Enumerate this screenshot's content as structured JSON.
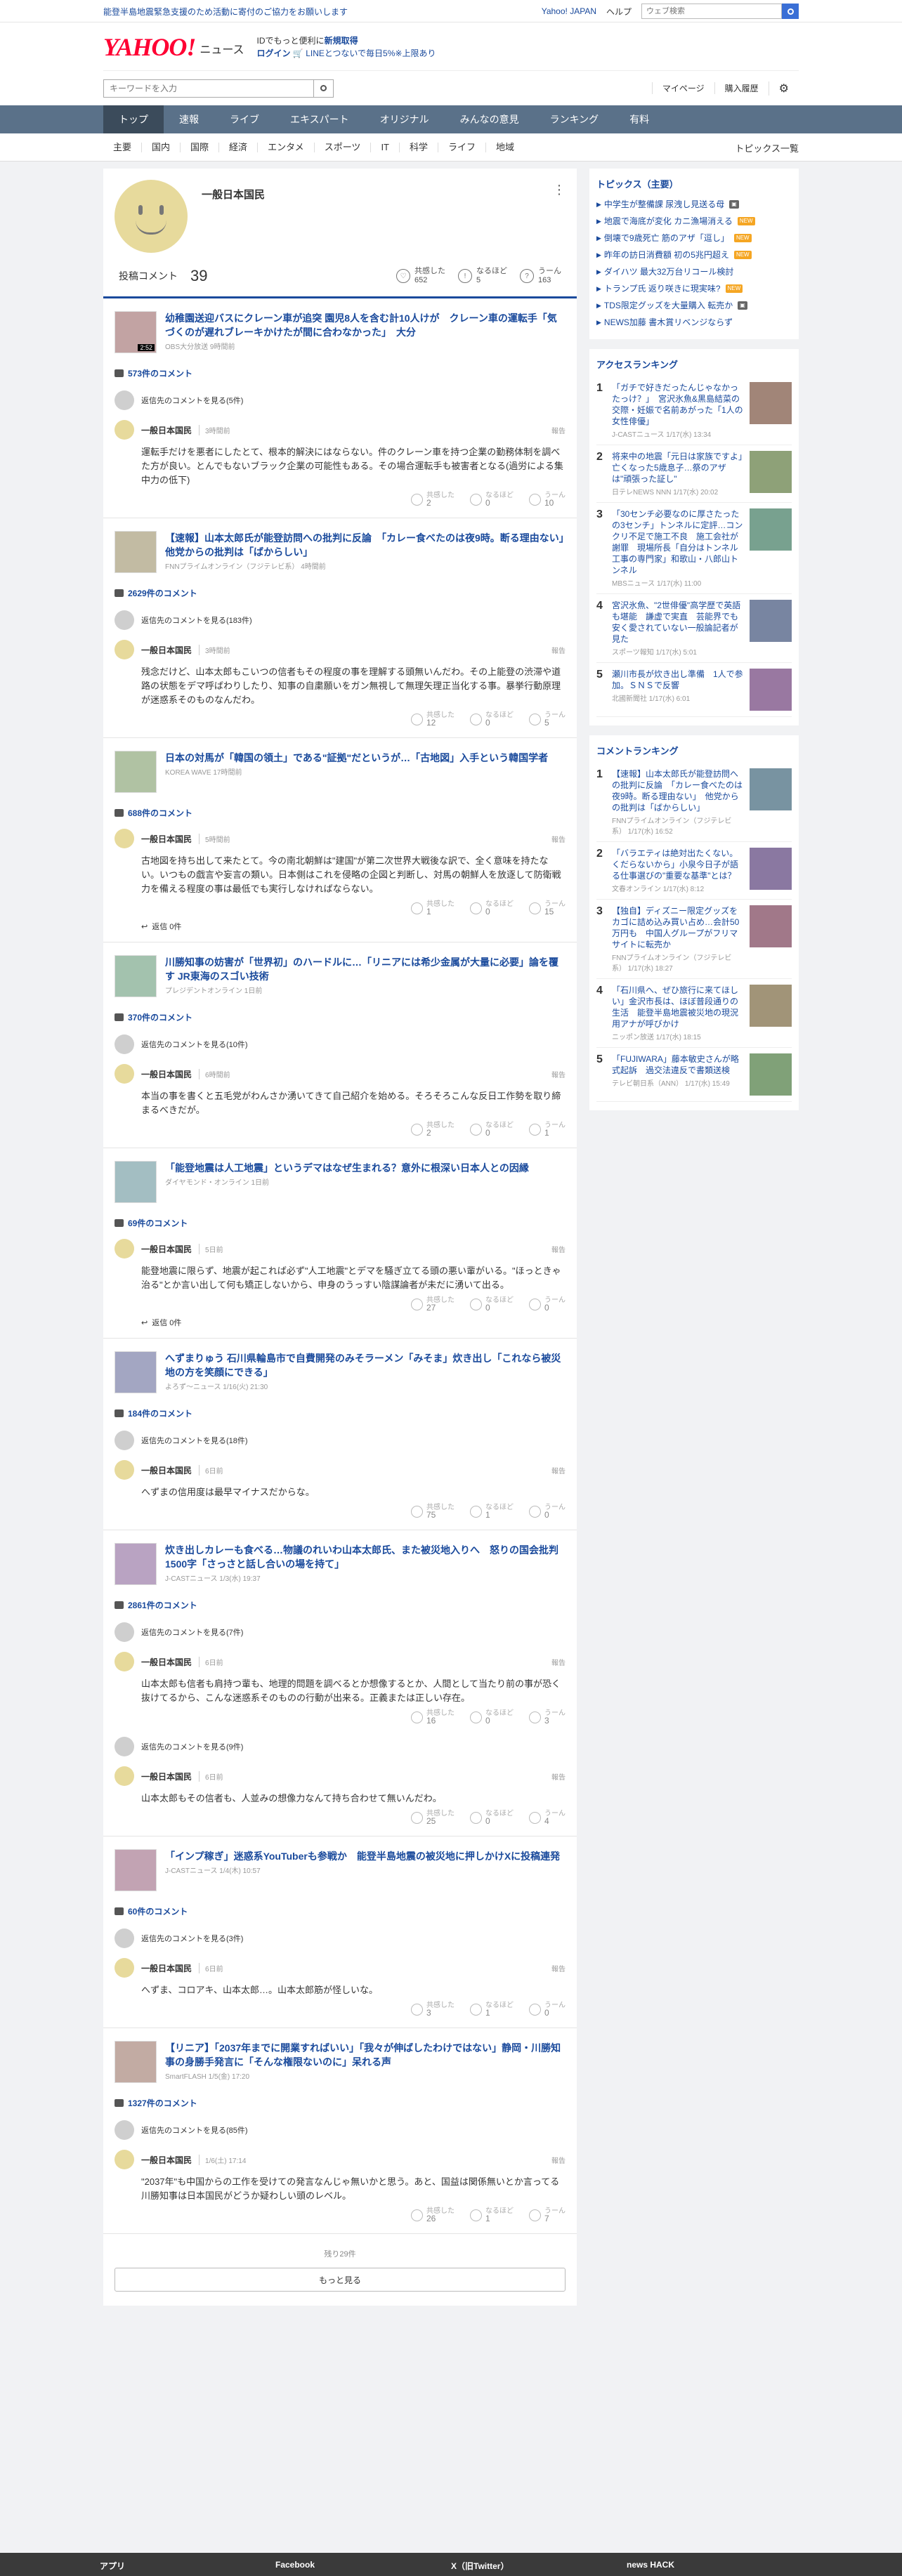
{
  "topbar": {
    "notice": "能登半島地震緊急支援のため活動に寄付のご協力をお願いします",
    "yahoo_japan": "Yahoo! JAPAN",
    "help": "ヘルプ",
    "search_placeholder": "ウェブ検索"
  },
  "header": {
    "logo_text": "YAHOO!",
    "logo_sub": "JAPAN",
    "service": "ニュース",
    "promo_line1": "IDでもっと便利に",
    "promo_new": "新規取得",
    "promo_login": "ログイン",
    "promo_line2": "LINEとつないで毎日5%※上限あり"
  },
  "search": {
    "placeholder": "キーワードを入力",
    "mypage": "マイページ",
    "purchase": "購入履歴"
  },
  "gnav": [
    "トップ",
    "速報",
    "ライブ",
    "エキスパート",
    "オリジナル",
    "みんなの意見",
    "ランキング",
    "有料"
  ],
  "snav": [
    "主要",
    "国内",
    "国際",
    "経済",
    "エンタメ",
    "スポーツ",
    "IT",
    "科学",
    "ライフ",
    "地域"
  ],
  "snav_right": "トピックス一覧",
  "profile": {
    "name": "一般日本国民",
    "comment_label": "投稿コメント",
    "comment_count": "39",
    "r1_label": "共感した",
    "r1": "652",
    "r2_label": "なるほど",
    "r2": "5",
    "r3_label": "うーん",
    "r3": "163"
  },
  "labels": {
    "more_replies": "返信先のコメントを見る",
    "report": "報告",
    "reply": "返信 0件",
    "empathy": "共感した",
    "naruhodo": "なるほど",
    "uun": "うーん",
    "user": "一般日本国民"
  },
  "articles": [
    {
      "title": "幼稚園送迎バスにクレーン車が追突 園児8人を含む計10人けが　クレーン車の運転手「気づくのが遅れブレーキかけたが間に合わなかった」　大分",
      "src": "OBS大分放送 9時間前",
      "thumb_time": "2:52",
      "count": "573件のコメント",
      "more": "返信先のコメントを見る(5件)",
      "comments": [
        {
          "time": "3時間前",
          "text": "運転手だけを悪者にしたとて、根本的解決にはならない。件のクレーン車を持つ企業の勤務体制を調べた方が良い。とんでもないブラック企業の可能性もある。その場合運転手も被害者となる(過労による集中力の低下)",
          "r": [
            "2",
            "0",
            "10"
          ]
        }
      ]
    },
    {
      "title": "【速報】山本太郎氏が能登訪問への批判に反論　「カレー食べたのは夜9時。断る理由ない」　他党からの批判は「ばからしい」",
      "src": "FNNプライムオンライン（フジテレビ系） 4時間前",
      "count": "2629件のコメント",
      "more": "返信先のコメントを見る(183件)",
      "comments": [
        {
          "time": "3時間前",
          "text": "残念だけど、山本太郎もこいつの信者もその程度の事を理解する頭無いんだわ。その上能登の渋滞や道路の状態をデマ呼ばわりしたり、知事の自粛願いをガン無視して無理矢理正当化する事。暴挙行動原理が迷惑系そのものなんだわ。",
          "r": [
            "12",
            "0",
            "5"
          ]
        }
      ]
    },
    {
      "title": "日本の対馬が「韓国の領土」である\"証拠\"だというが…「古地図」入手という韓国学者",
      "src": "KOREA WAVE 17時間前",
      "count": "688件のコメント",
      "more": "",
      "comments": [
        {
          "time": "5時間前",
          "text": "古地図を持ち出して来たとて。今の南北朝鮮は\"建国\"が第二次世界大戦後な訳で、全く意味を持たない。いつもの戯言や妄言の類い。日本側はこれを侵略の企図と判断し、対馬の朝鮮人を放逐して防衛戦力を備える程度の事は最低でも実行しなければならない。",
          "r": [
            "1",
            "0",
            "15"
          ],
          "reply": true
        }
      ]
    },
    {
      "title": "川勝知事の妨害が「世界初」のハードルに…「リニアには希少金属が大量に必要」論を覆す JR東海のスゴい技術",
      "src": "プレジデントオンライン 1日前",
      "count": "370件のコメント",
      "more": "返信先のコメントを見る(10件)",
      "comments": [
        {
          "time": "6時間前",
          "text": "本当の事を書くと五毛党がわんさか湧いてきて自己紹介を始める。そろそろこんな反日工作勢を取り締まるべきだが。",
          "r": [
            "2",
            "0",
            "1"
          ]
        }
      ]
    },
    {
      "title": "「能登地震は人工地震」というデマはなぜ生まれる？意外に根深い日本人との因縁",
      "src": "ダイヤモンド・オンライン 1日前",
      "count": "69件のコメント",
      "more": "",
      "comments": [
        {
          "time": "5日前",
          "text": "能登地震に限らず、地震が起これば必ず\"人工地震\"とデマを騒ぎ立てる頭の悪い輩がいる。\"ほっときゃ治る\"とか言い出して何も矯正しないから、申身のうっすい陰謀論者が未だに湧いて出る。",
          "r": [
            "27",
            "0",
            "0"
          ],
          "reply": true
        }
      ]
    },
    {
      "title": "へずまりゅう 石川県輪島市で自費開発のみそラーメン「みそま」炊き出し「これなら被災地の方を笑顔にできる」",
      "src": "よろず〜ニュース 1/16(火) 21:30",
      "count": "184件のコメント",
      "more": "返信先のコメントを見る(18件)",
      "comments": [
        {
          "time": "6日前",
          "text": "へずまの信用度は最早マイナスだからな。",
          "r": [
            "75",
            "1",
            "0"
          ]
        }
      ]
    },
    {
      "title": "炊き出しカレーも食べる…物議のれいわ山本太郎氏、また被災地入りへ　怒りの国会批判1500字「さっさと話し合いの場を持て」",
      "src": "J-CASTニュース 1/3(水) 19:37",
      "count": "2861件のコメント",
      "more": "返信先のコメントを見る(7件)",
      "comments": [
        {
          "time": "6日前",
          "text": "山本太郎も信者も肩持つ輩も、地理的問題を調べるとか想像するとか、人間として当たり前の事が恐く抜けてるから、こんな迷惑系そのものの行動が出来る。正義または正しい存在。",
          "r": [
            "16",
            "0",
            "3"
          ],
          "more2": "返信先のコメントを見る(9件)"
        },
        {
          "time": "6日前",
          "text": "山本太郎もその信者も、人並みの想像力なんて持ち合わせて無いんだわ。",
          "r": [
            "25",
            "0",
            "4"
          ]
        }
      ]
    },
    {
      "title": "「インプ稼ぎ」迷惑系YouTuberも参戦か　能登半島地震の被災地に押しかけXに投稿連発",
      "src": "J-CASTニュース 1/4(木) 10:57",
      "count": "60件のコメント",
      "more": "返信先のコメントを見る(3件)",
      "comments": [
        {
          "time": "6日前",
          "text": "へずま、コロアキ、山本太郎…。山本太郎筋が怪しいな。",
          "r": [
            "3",
            "1",
            "0"
          ]
        }
      ]
    },
    {
      "title": "【リニア】「2037年までに開業すればいい」「我々が伸ばしたわけではない」静岡・川勝知事の身勝手発言に「そんな権限ないのに」呆れる声",
      "src": "SmartFLASH 1/5(金) 17:20",
      "count": "1327件のコメント",
      "more": "返信先のコメントを見る(85件)",
      "comments": [
        {
          "time": "1/6(土) 17:14",
          "text": "\"2037年\"も中国からの工作を受けての発言なんじゃ無いかと思う。あと、国益は関係無いとか言ってる川勝知事は日本国民がどうか疑わしい頭のレベル。",
          "r": [
            "26",
            "1",
            "7"
          ]
        }
      ]
    }
  ],
  "footer": {
    "remaining": "残り29件",
    "more": "もっと見る"
  },
  "topics": {
    "title": "トピックス（主要）",
    "items": [
      {
        "t": "中学生が整備課 尿洩し見送る母",
        "b": "img"
      },
      {
        "t": "地震で海底が変化 カニ漁場消える",
        "b": "new"
      },
      {
        "t": "倒壊で9歳死亡 筋のアザ「逗し」",
        "b": "new"
      },
      {
        "t": "昨年の訪日消費額 初の5兆円超え",
        "b": "new"
      },
      {
        "t": "ダイハツ 最大32万台リコール検討",
        "b": ""
      },
      {
        "t": "トランプ氏 返り咲きに現実味?",
        "b": "new"
      },
      {
        "t": "TDS限定グッズを大量購入 転売か",
        "b": "img"
      },
      {
        "t": "NEWS加藤 書木賞リベンジならず",
        "b": ""
      }
    ]
  },
  "access": {
    "title": "アクセスランキング",
    "items": [
      {
        "t": "「ガチで好きだったんじゃなかったっけ？」　宮沢氷魚&黒島結菜の交際・妊娠で名前あがった「1人の女性俳優」",
        "s": "J-CASTニュース 1/17(水) 13:34"
      },
      {
        "t": "将来中の地震「元日は家族ですよ」　亡くなった5歳息子…祭のアザは\"頑張った証し\"",
        "s": "日テレNEWS NNN 1/17(水) 20:02"
      },
      {
        "t": "「30センチ必要なのに厚さたったの3センチ」トンネルに定評…コンクリ不足で施工不良　施工会社が謝罪　現場所長「自分はトンネル工事の専門家」和歌山・八郎山トンネル",
        "s": "MBSニュース 1/17(水) 11:00"
      },
      {
        "t": "宮沢氷魚、\"2世俳優\"高学歴で英語も堪能　謙虚で実直　芸能界でも安く愛されていない一般論記者が見た",
        "s": "スポーツ報知 1/17(水) 5:01"
      },
      {
        "t": "瀬川市長が炊き出し準備　1人で参加。ＳＮＳで反響",
        "s": "北國新聞社 1/17(水) 6:01"
      }
    ]
  },
  "commentrank": {
    "title": "コメントランキング",
    "items": [
      {
        "t": "【速報】山本太郎氏が能登訪問への批判に反論　「カレー食べたのは夜9時。断る理由ない」　他党からの批判は「ばからしい」",
        "s": "FNNプライムオンライン（フジテレビ系） 1/17(水) 16:52"
      },
      {
        "t": "「バラエティは絶対出たくない。くだらないから」小泉今日子が語る仕事選びの\"重要な基準\"とは？",
        "s": "文春オンライン 1/17(水) 8:12"
      },
      {
        "t": "【独自】ディズニー限定グッズをカゴに詰め込み買い占め…会計50万円も　中国人グループがフリマサイトに転売か",
        "s": "FNNプライムオンライン（フジテレビ系） 1/17(水) 18:27"
      },
      {
        "t": "「石川県へ、ぜひ旅行に来てほしい」金沢市長は、ほぼ普段通りの生活　能登半島地震被災地の現況用アナが呼びかけ",
        "s": "ニッポン放送 1/17(水) 18:15"
      },
      {
        "t": "「FUJIWARA」藤本敏史さんが略式起訴　過交法違反で書類送検",
        "s": "テレビ朝日系（ANN） 1/17(水) 15:49"
      }
    ]
  },
  "bottom": [
    "アプリ",
    "Facebook",
    "X（旧Twitter）",
    "news HACK"
  ],
  "colors": {
    "accent": "#1a4a9c",
    "nav": "#5a7189",
    "brand": "#ff0033"
  }
}
